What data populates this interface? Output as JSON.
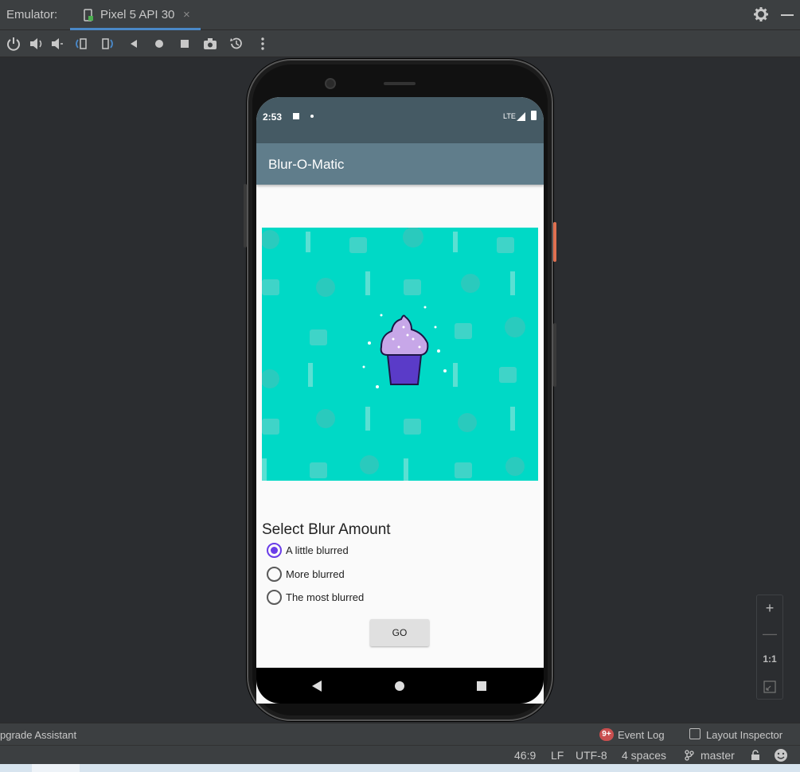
{
  "header": {
    "emulator_label": "Emulator:",
    "tab_label": "Pixel 5 API 30",
    "tab_close": "×"
  },
  "toolbar": {
    "icons": [
      "power-icon",
      "volume-up-icon",
      "volume-down-icon",
      "rotate-left-icon",
      "rotate-right-icon",
      "back-icon",
      "home-icon",
      "overview-icon",
      "screenshot-icon",
      "snapshot-icon",
      "more-icon"
    ]
  },
  "phone": {
    "status_time": "2:53",
    "status_lte": "LTE",
    "app_title": "Blur-O-Matic",
    "section_title": "Select Blur Amount",
    "options": [
      {
        "label": "A little blurred",
        "checked": true
      },
      {
        "label": "More blurred",
        "checked": false
      },
      {
        "label": "The most blurred",
        "checked": false
      }
    ],
    "go_label": "GO"
  },
  "zoom": {
    "plus": "+",
    "minus": "—",
    "one_to_one": "1:1"
  },
  "bottom": {
    "upgrade": "pgrade Assistant",
    "event_badge": "9+",
    "event_log": "Event Log",
    "layout_inspector": "Layout Inspector"
  },
  "status": {
    "position": "46:9",
    "line_sep": "LF",
    "encoding": "UTF-8",
    "indent": "4 spaces",
    "branch": "master"
  },
  "colors": {
    "accent": "#6a3de8",
    "appbar": "#607d8b",
    "statusbar": "#455a64",
    "image_bg": "#00d9c6"
  }
}
